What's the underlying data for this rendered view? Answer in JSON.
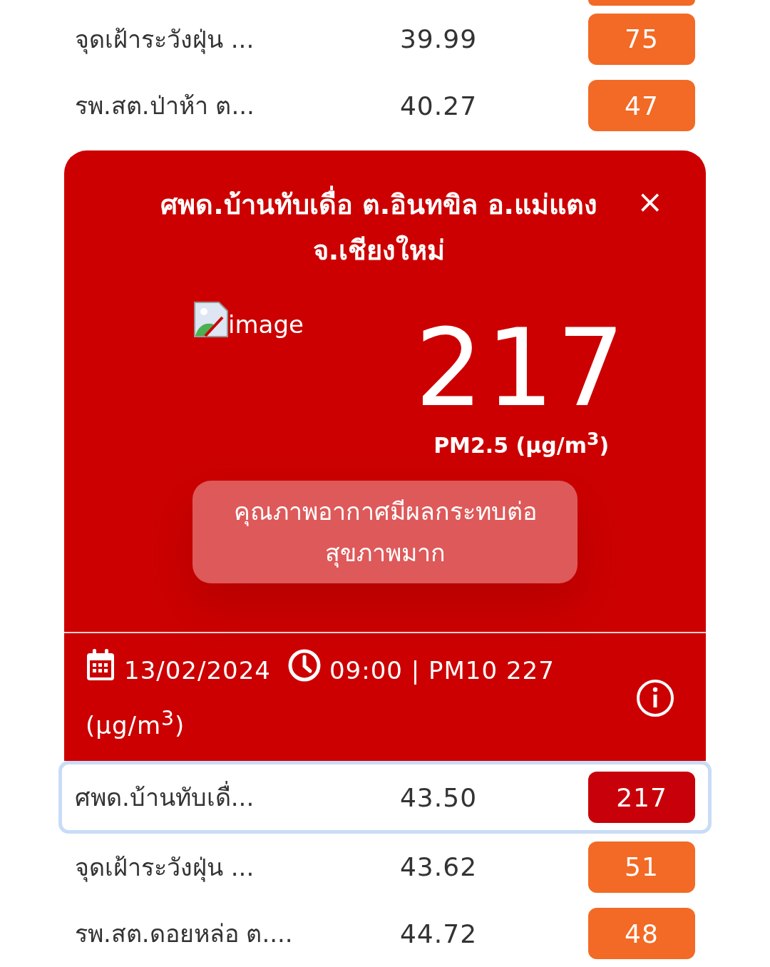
{
  "top_cut_badge": {
    "color": "#f26a25"
  },
  "rows_above": [
    {
      "name": "จุดเฝ้าระวังฝุ่น ...",
      "value": "39.99",
      "aqi": "75",
      "color": "#f26a25",
      "selected": false
    },
    {
      "name": "รพ.สต.ป่าห้า ต...",
      "value": "40.27",
      "aqi": "47",
      "color": "#f26a25",
      "selected": false
    }
  ],
  "popup": {
    "title": "ศพด.บ้านทับเดื่อ ต.อินทขิล อ.แม่แตง จ.เชียงใหม่",
    "close": "×",
    "image_alt": "image",
    "pm25": "217",
    "unit": "PM2.5 (µg/m$^{3}$)",
    "status": "คุณภาพอากาศมีผลกระทบต่อสุขภาพมาก",
    "date": "13/02/2024",
    "time_line": "09:00 | PM10 227",
    "pm10_unit": "(µg/m$^{3}$)"
  },
  "rows_below": [
    {
      "name": "ศพด.บ้านทับเดื่...",
      "value": "43.50",
      "aqi": "217",
      "color": "#c8000a",
      "selected": true
    },
    {
      "name": "จุดเฝ้าระวังฝุ่น ...",
      "value": "43.62",
      "aqi": "51",
      "color": "#f26a25",
      "selected": false
    },
    {
      "name": "รพ.สต.ดอยหล่อ ต....",
      "value": "44.72",
      "aqi": "48",
      "color": "#f26a25",
      "selected": false
    }
  ]
}
